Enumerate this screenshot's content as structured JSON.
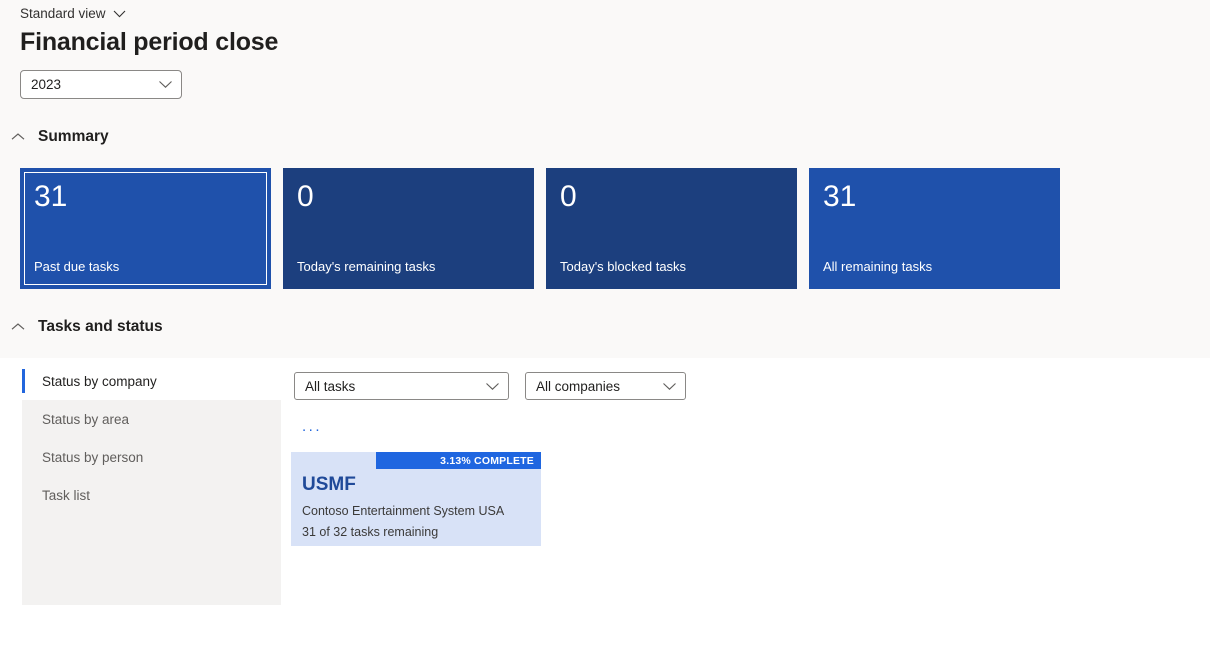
{
  "header": {
    "view_selector_label": "Standard view",
    "view_selector_icon": "chevron-down-icon",
    "page_title": "Financial period close",
    "year_filter": {
      "value": "2023",
      "icon": "chevron-down-icon"
    }
  },
  "sections": {
    "summary": {
      "label": "Summary",
      "icon": "chevron-up-icon",
      "tiles": [
        {
          "count": "31",
          "caption": "Past due tasks",
          "color": "#1f51ab",
          "selected": true
        },
        {
          "count": "0",
          "caption": "Today's remaining tasks",
          "color": "#1c3f7e",
          "selected": false
        },
        {
          "count": "0",
          "caption": "Today's blocked tasks",
          "color": "#1c3f7e",
          "selected": false
        },
        {
          "count": "31",
          "caption": "All remaining tasks",
          "color": "#1f51ab",
          "selected": false
        }
      ]
    },
    "tasks_and_status": {
      "label": "Tasks and status",
      "icon": "chevron-up-icon",
      "nav_items": [
        {
          "label": "Status by company",
          "active": true
        },
        {
          "label": "Status by area",
          "active": false
        },
        {
          "label": "Status by person",
          "active": false
        },
        {
          "label": "Task list",
          "active": false
        }
      ],
      "filters": {
        "tasks": {
          "value": "All tasks",
          "icon": "chevron-down-icon"
        },
        "companies": {
          "value": "All companies",
          "icon": "chevron-down-icon"
        },
        "more_options_label": "..."
      },
      "company_cards": [
        {
          "progress_banner": "3.13% COMPLETE",
          "code": "USMF",
          "description": "Contoso Entertainment System USA",
          "remaining": "31 of 32 tasks remaining",
          "banner_color": "#1f66e0",
          "card_color": "#d8e2f7"
        }
      ]
    }
  }
}
